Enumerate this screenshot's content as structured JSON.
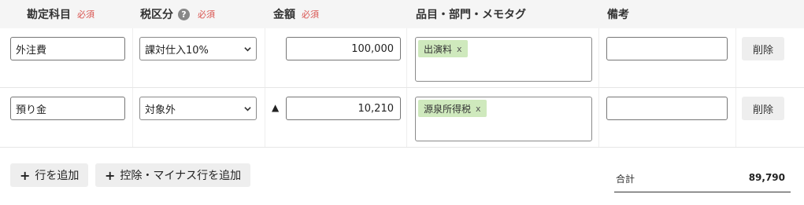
{
  "columns": {
    "account": "勘定科目",
    "tax": "税区分",
    "amount": "金額",
    "tags": "品目・部門・メモタグ",
    "note": "備考",
    "required": "必須",
    "help": "?"
  },
  "rows": [
    {
      "account": "外注費",
      "tax": "課対仕入10%",
      "minus": "",
      "amount": "100,000",
      "tag": "出演料",
      "tag_remove": "x",
      "note": "",
      "delete": "削除"
    },
    {
      "account": "預り金",
      "tax": "対象外",
      "minus": "▲",
      "amount": "10,210",
      "tag": "源泉所得税",
      "tag_remove": "x",
      "note": "",
      "delete": "削除"
    }
  ],
  "actions": {
    "add_row_icon": "+",
    "add_row": "行を追加",
    "add_deduction_icon": "+",
    "add_deduction": "控除・マイナス行を追加"
  },
  "total": {
    "label": "合計",
    "value": "89,790"
  }
}
